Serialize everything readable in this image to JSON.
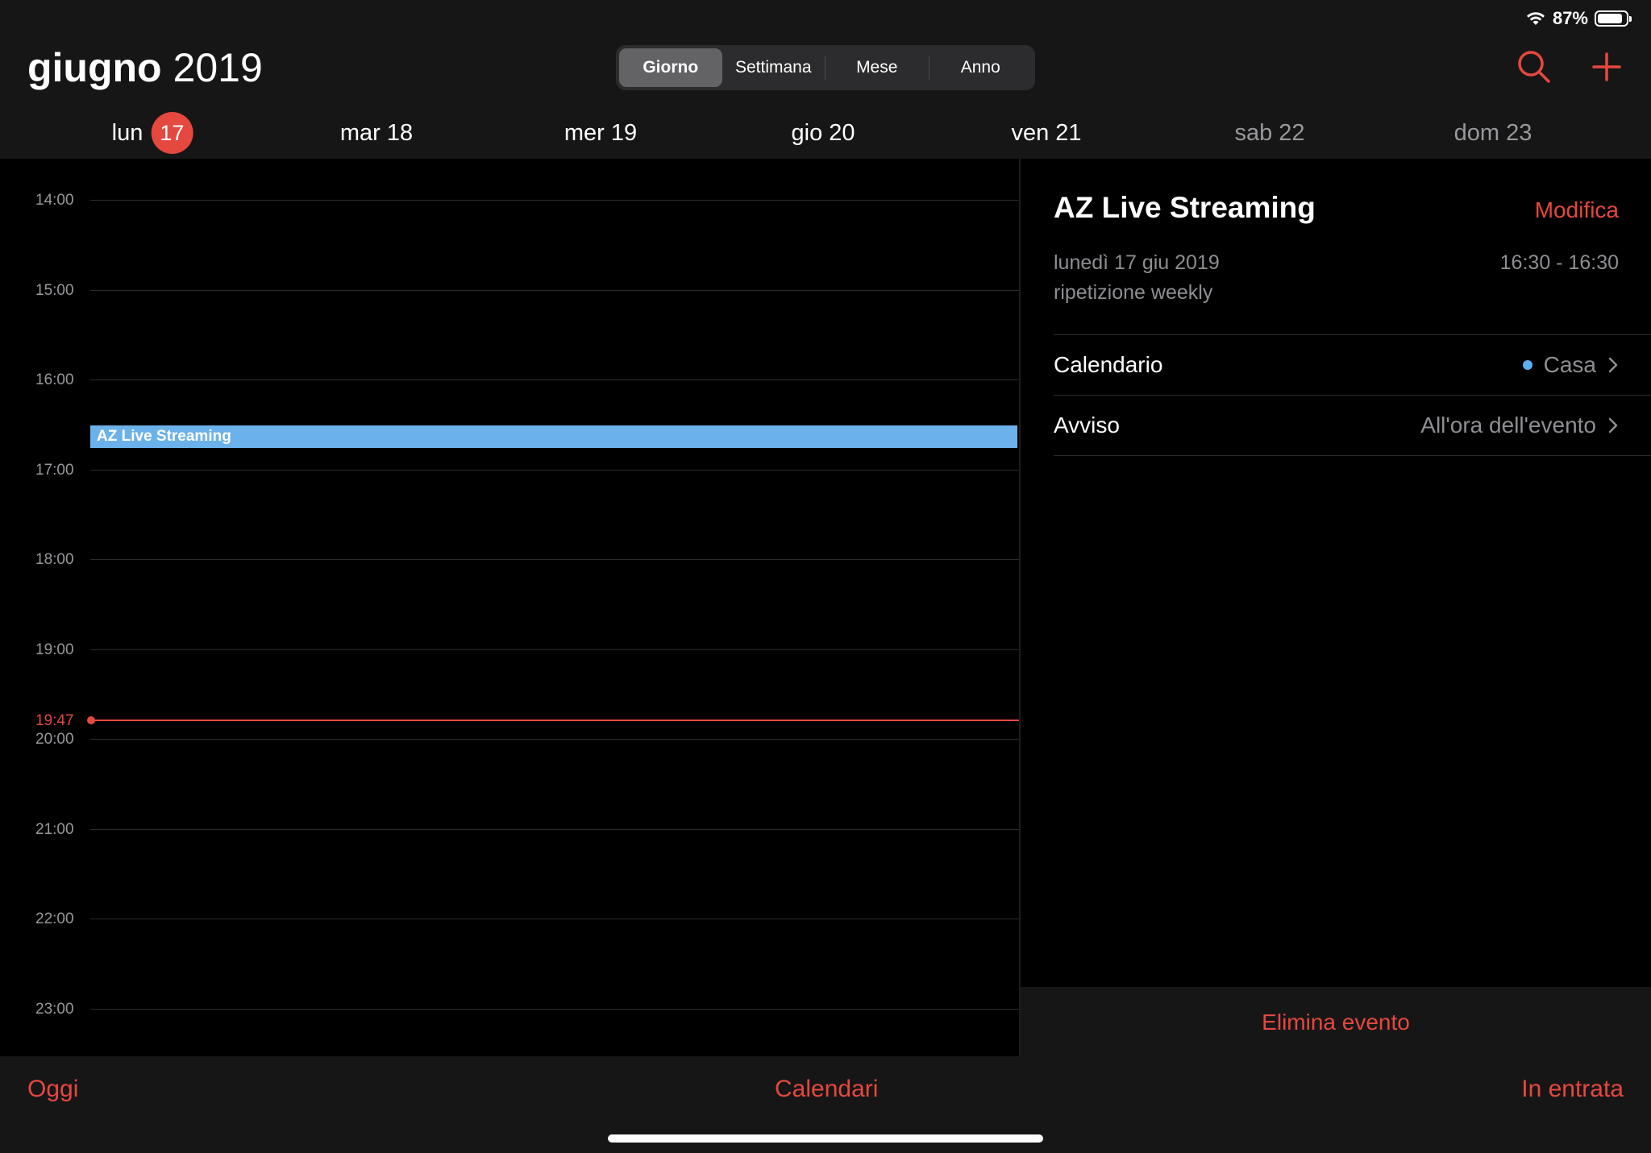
{
  "status_bar": {
    "battery_pct": "87%",
    "battery_level": 0.87
  },
  "header": {
    "month": "giugno",
    "year": "2019",
    "view_tabs": [
      "Giorno",
      "Settimana",
      "Mese",
      "Anno"
    ],
    "active_tab": "Giorno",
    "search_icon": "search-icon",
    "add_icon": "plus-icon"
  },
  "week": [
    {
      "label": "lun",
      "num": "17",
      "today": true
    },
    {
      "label": "mar 18"
    },
    {
      "label": "mer 19"
    },
    {
      "label": "gio 20"
    },
    {
      "label": "ven 21"
    },
    {
      "label": "sab 22",
      "weekend": true
    },
    {
      "label": "dom 23",
      "weekend": true
    }
  ],
  "hours": [
    "14:00",
    "15:00",
    "16:00",
    "17:00",
    "18:00",
    "19:00",
    "20:00",
    "21:00",
    "22:00",
    "23:00"
  ],
  "current_time": "19:47",
  "event": {
    "title": "AZ Live Streaming",
    "color": "#6cb2ea"
  },
  "detail": {
    "title": "AZ Live Streaming",
    "edit_label": "Modifica",
    "date": "lunedì 17 giu 2019",
    "time": "16:30 - 16:30",
    "repeat": "ripetizione weekly",
    "calendar_label": "Calendario",
    "calendar_value": "Casa",
    "calendar_color": "#5ab0f0",
    "alert_label": "Avviso",
    "alert_value": "All'ora dell'evento",
    "delete_label": "Elimina evento"
  },
  "toolbar": {
    "today": "Oggi",
    "calendars": "Calendari",
    "inbox": "In entrata"
  },
  "colors": {
    "accent": "#e5483f",
    "background": "#161616",
    "grid": "#000000"
  }
}
